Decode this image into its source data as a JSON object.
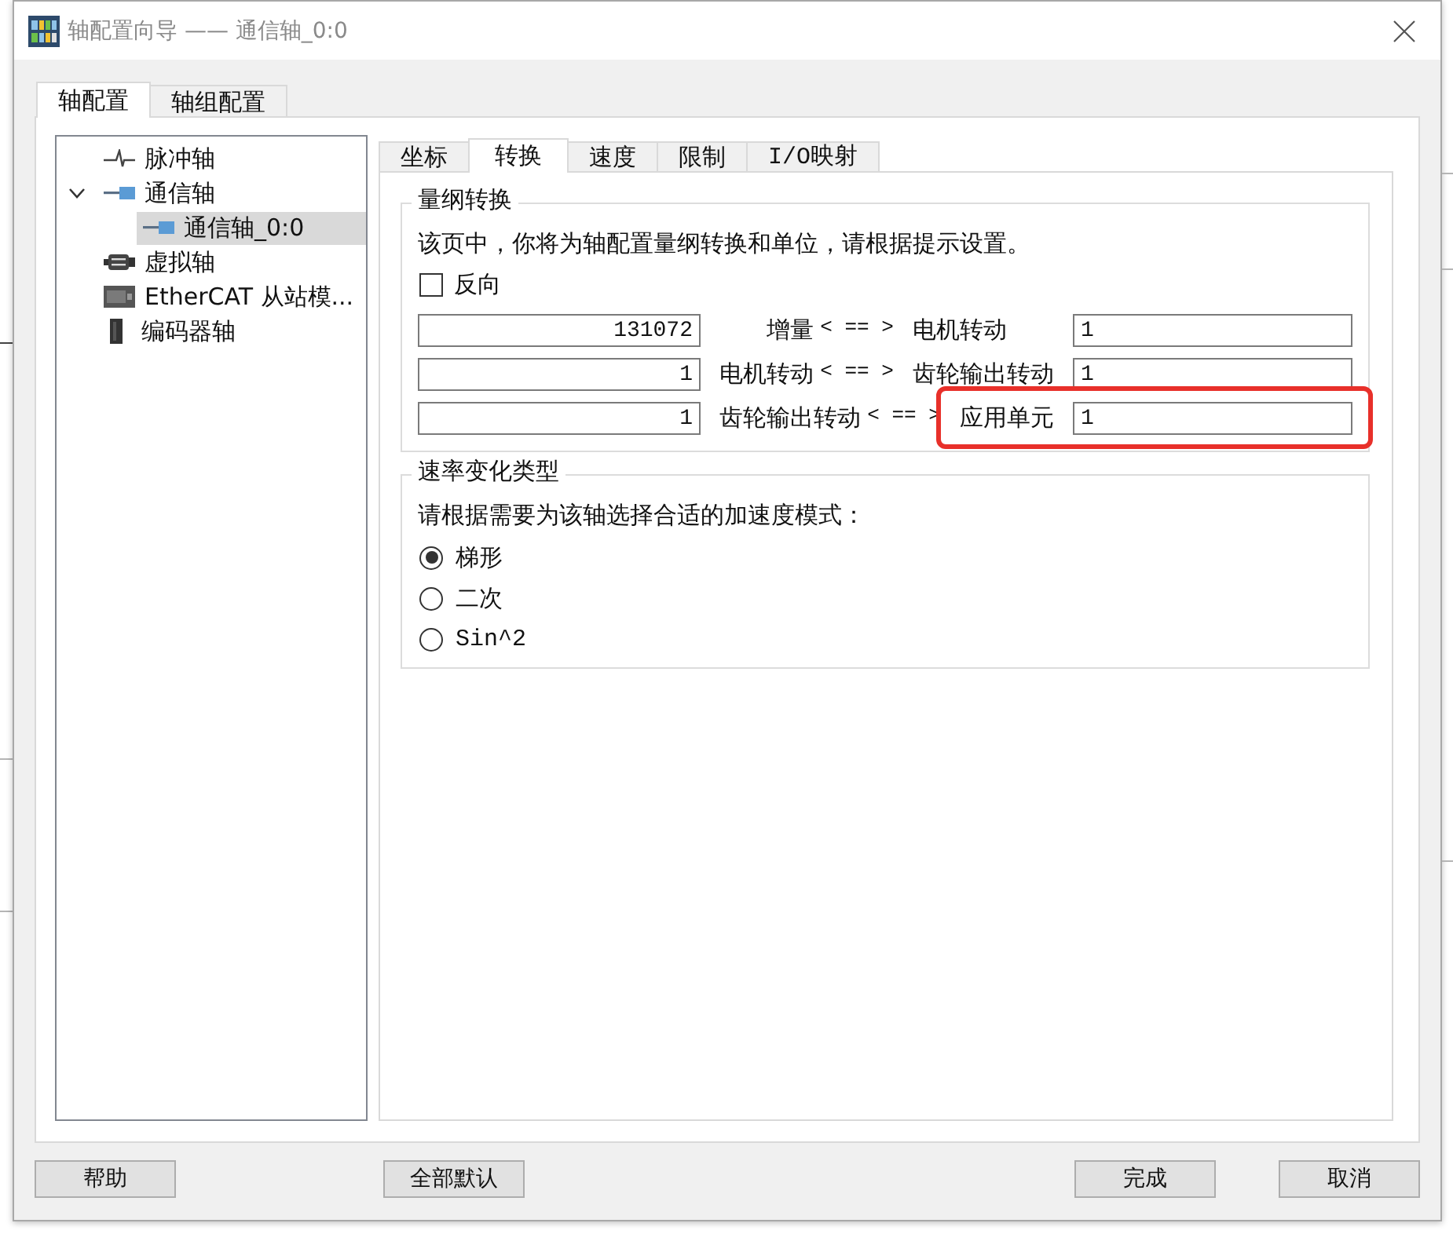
{
  "window": {
    "title": "轴配置向导 —— 通信轴_0:0"
  },
  "tabs": [
    {
      "label": "轴配置",
      "selected": true
    },
    {
      "label": "轴组配置",
      "selected": false
    }
  ],
  "tree": [
    {
      "label": "脉冲轴",
      "kind": "pulse",
      "selected": false
    },
    {
      "label": "通信轴",
      "kind": "comm",
      "selected": false,
      "expanded": true,
      "children": [
        {
          "label": "通信轴_0:0",
          "kind": "comm",
          "selected": true
        }
      ]
    },
    {
      "label": "虚拟轴",
      "kind": "virtual",
      "selected": false
    },
    {
      "label": "EtherCAT 从站模...",
      "kind": "ethercat",
      "selected": false
    },
    {
      "label": "编码器轴",
      "kind": "encoder",
      "selected": false
    }
  ],
  "subtabs": [
    {
      "label": "坐标",
      "selected": false
    },
    {
      "label": "转换",
      "selected": true
    },
    {
      "label": "速度",
      "selected": false
    },
    {
      "label": "限制",
      "selected": false
    },
    {
      "label": "I/O映射",
      "selected": false
    }
  ],
  "scaling": {
    "title": "量纲转换",
    "description": "该页中，你将为轴配置量纲转换和单位，请根据提示设置。",
    "reverse": {
      "label": "反向",
      "checked": false
    },
    "rows": [
      {
        "left_value": "131072",
        "from": "增量",
        "separator": "< == >",
        "to": "电机转动",
        "right_value": "1",
        "highlighted": false
      },
      {
        "left_value": "1",
        "from": "电机转动",
        "separator": "< == >",
        "to": "齿轮输出转动",
        "right_value": "1",
        "highlighted": false
      },
      {
        "left_value": "1",
        "from": "齿轮输出转动",
        "separator": "< == >",
        "to": "应用单元",
        "right_value": "1",
        "highlighted": true
      }
    ]
  },
  "ramp": {
    "title": "速率变化类型",
    "prompt": "请根据需要为该轴选择合适的加速度模式：",
    "options": [
      {
        "label": "梯形",
        "selected": true
      },
      {
        "label": "二次",
        "selected": false
      },
      {
        "label": "Sin^2",
        "selected": false
      }
    ]
  },
  "buttons": {
    "left": [
      "帮助",
      "全部默认"
    ],
    "right": [
      "完成",
      "取消"
    ]
  }
}
